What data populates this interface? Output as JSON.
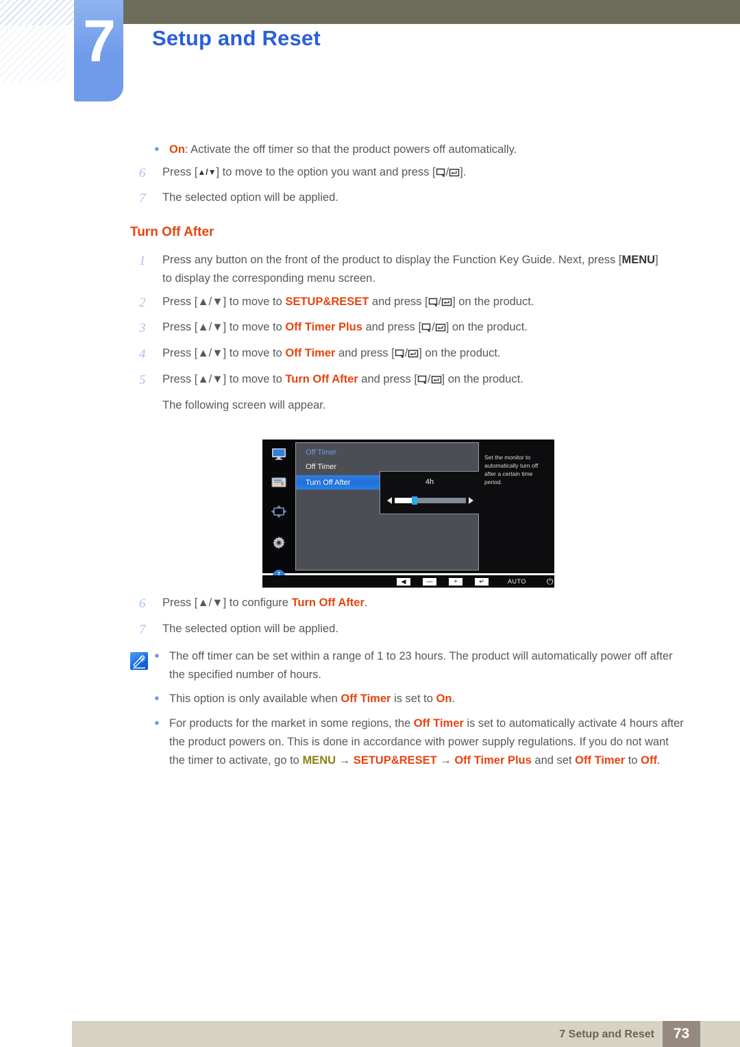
{
  "header": {
    "chapter_number": "7",
    "chapter_title": "Setup and Reset"
  },
  "intro": {
    "bullet_on_label": "On",
    "bullet_on_text": ": Activate the off timer so that the product powers off automatically.",
    "step6_num": "6",
    "step6_a": "Press [",
    "step6_keys": "▲/▼",
    "step6_b": "] to move to the option you want and press [",
    "step6_c": "].",
    "step7_num": "7",
    "step7_text": "The selected option will be applied."
  },
  "section": {
    "heading": "Turn Off After"
  },
  "steps": [
    {
      "num": "1",
      "pre": "Press any button on the front of the product to display the Function Key Guide. Next, press [",
      "key": "MENU",
      "post": "]",
      "line2": "to display the corresponding menu screen."
    },
    {
      "num": "2",
      "pre": "Press [▲/▼] to move to ",
      "target": "SETUP&RESET",
      "mid": " and press [",
      "post": "] on the product."
    },
    {
      "num": "3",
      "pre": "Press [▲/▼] to move to ",
      "target": "Off Timer Plus",
      "mid": " and press [",
      "post": "] on the product."
    },
    {
      "num": "4",
      "pre": "Press [▲/▼] to move to ",
      "target": "Off Timer",
      "mid": " and press [",
      "post": "] on the product."
    },
    {
      "num": "5",
      "pre": "Press [▲/▼] to move to ",
      "target": "Turn Off After",
      "mid": " and press [",
      "post": "] on the product."
    }
  ],
  "following_screen_text": "The following screen will appear.",
  "osd": {
    "title": "Off Timer",
    "item1": "Off Timer",
    "item2_selected": "Turn Off After",
    "slider_value": "4h",
    "help_text": "Set the monitor to automatically turn off after a certain time period.",
    "buttons": {
      "back": "◀",
      "minus": "—",
      "plus": "+",
      "enter": "↵",
      "auto": "AUTO",
      "power": "⏻"
    },
    "rail_icons": [
      "monitor-icon",
      "color-settings-icon",
      "screen-position-icon",
      "gear-setup-icon",
      "information-icon"
    ]
  },
  "after_steps": [
    {
      "num": "6",
      "pre": "Press [▲/▼] to configure ",
      "target": "Turn Off After",
      "post": "."
    },
    {
      "num": "7",
      "pre": "The selected option will be applied.",
      "target": "",
      "post": ""
    }
  ],
  "notes": {
    "icon_name": "note-pencil-icon",
    "items": [
      {
        "text_1": "The off timer can be set within a range of 1 to 23 hours. The product will automatically power off after the specified number of hours."
      },
      {
        "text_1": "This option is only available when ",
        "em1": "Off Timer",
        "text_2": " is set to ",
        "em2": "On",
        "text_3": "."
      },
      {
        "text_1": "For products for the market in some regions, the ",
        "em1": "Off Timer",
        "text_2": " is set to automatically activate 4 hours after the product powers on. This is done in accordance with power supply regulations. If you do not want the timer to activate, go to ",
        "em_menu": "MENU",
        "arrow1": "→",
        "em3": "SETUP&RESET",
        "arrow2": "→",
        "em4": "Off Timer Plus",
        "text_3": " and set ",
        "em5": "Off Timer",
        "text_4": " to ",
        "em6": "Off",
        "text_5": "."
      }
    ]
  },
  "footer": {
    "label": "7 Setup and Reset",
    "page": "73"
  },
  "colors": {
    "accent_blue": "#2a5fd9",
    "tab_blue": "#6f9bea",
    "orange": "#e8430f",
    "olive_bar": "#6d6d5a",
    "footer_bar": "#d7d3c2",
    "footer_page": "#968a80",
    "menu_olive": "#8a8112"
  }
}
